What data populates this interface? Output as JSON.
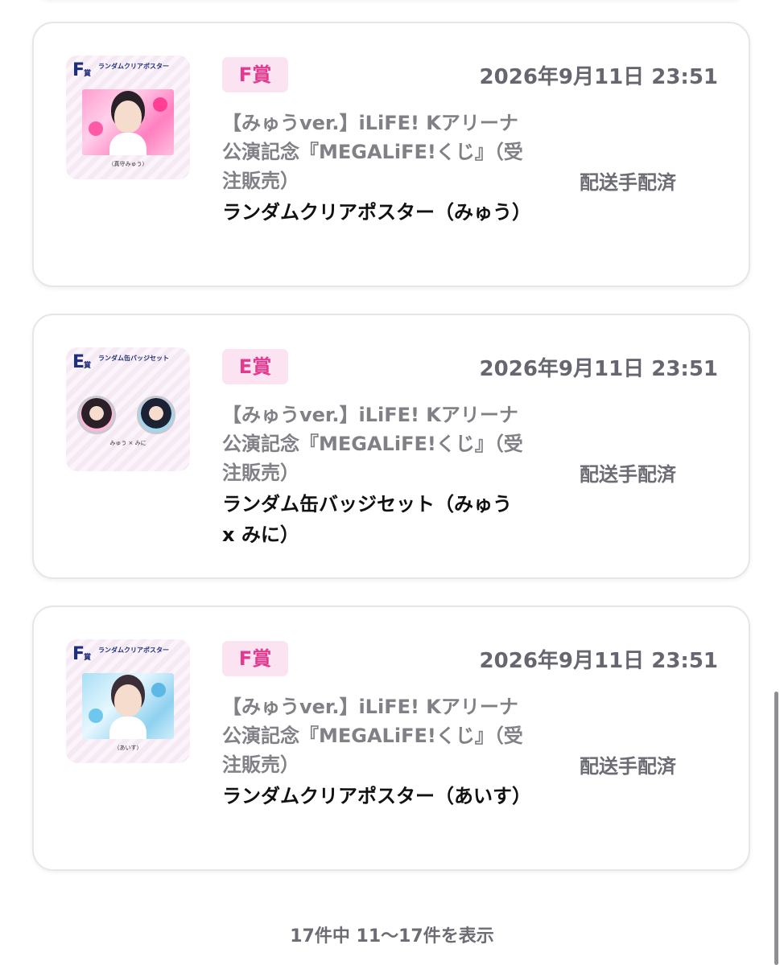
{
  "cards": [
    {
      "thumb": {
        "letter": "F",
        "letter_suffix": "賞",
        "title": "ランダムクリアポスター",
        "caption": "（真守みゅう）"
      },
      "prize": "F賞",
      "date": "2026年9月11日 23:51",
      "campaign": "【みゅうver.】iLiFE! Kアリーナ公演記念『MEGALiFE!くじ』（受注販売）",
      "item": "ランダムクリアポスター（みゅう）",
      "status": "配送手配済"
    },
    {
      "thumb": {
        "letter": "E",
        "letter_suffix": "賞",
        "title": "ランダム缶バッジセット",
        "caption": "みゅう × みに"
      },
      "prize": "E賞",
      "date": "2026年9月11日 23:51",
      "campaign": "【みゅうver.】iLiFE! Kアリーナ公演記念『MEGALiFE!くじ』（受注販売）",
      "item": "ランダム缶バッジセット（みゅう x みに）",
      "status": "配送手配済"
    },
    {
      "thumb": {
        "letter": "F",
        "letter_suffix": "賞",
        "title": "ランダムクリアポスター",
        "caption": "（あいす）"
      },
      "prize": "F賞",
      "date": "2026年9月11日 23:51",
      "campaign": "【みゅうver.】iLiFE! Kアリーナ公演記念『MEGALiFE!くじ』（受注販売）",
      "item": "ランダムクリアポスター（あいす）",
      "status": "配送手配済"
    }
  ],
  "pagination": "17件中 11〜17件を表示",
  "colors": {
    "prize_tag_bg": "#fbe3f1",
    "prize_tag_text": "#e4398e",
    "muted_text": "#808086",
    "card_border": "#e6e6ea"
  }
}
